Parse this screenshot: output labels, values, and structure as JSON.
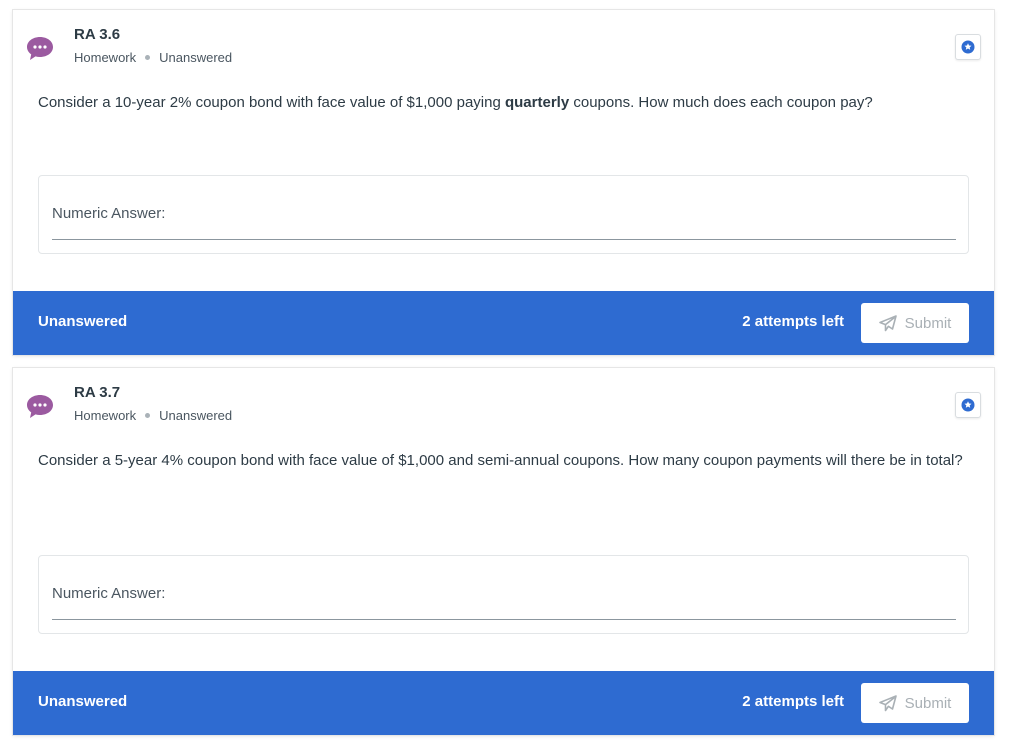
{
  "colors": {
    "accent_blue": "#2e6bd1",
    "chat_icon_purple": "#9b5aa0",
    "text_dark": "#2d3b45",
    "submit_disabled_text": "#a9b0b5"
  },
  "icons": {
    "chat": "chat-bubble-icon",
    "star": "star-badge-icon",
    "submit": "paper-plane-icon"
  },
  "questions": [
    {
      "title": "RA 3.6",
      "type": "Homework",
      "status": "Unanswered",
      "text_before": "Consider a 10-year 2% coupon bond with face value of $1,000 paying ",
      "text_bold": "quarterly",
      "text_after": " coupons. How much does each coupon pay?",
      "answer_label": "Numeric Answer:",
      "answer_value": "",
      "footer_status": "Unanswered",
      "attempts": "2 attempts left",
      "submit_label": "Submit"
    },
    {
      "title": "RA 3.7",
      "type": "Homework",
      "status": "Unanswered",
      "text": "Consider a 5-year 4% coupon bond with face value of $1,000 and semi-annual coupons. How many coupon payments will there be in total?",
      "answer_label": "Numeric Answer:",
      "answer_value": "",
      "footer_status": "Unanswered",
      "attempts": "2 attempts left",
      "submit_label": "Submit"
    }
  ]
}
